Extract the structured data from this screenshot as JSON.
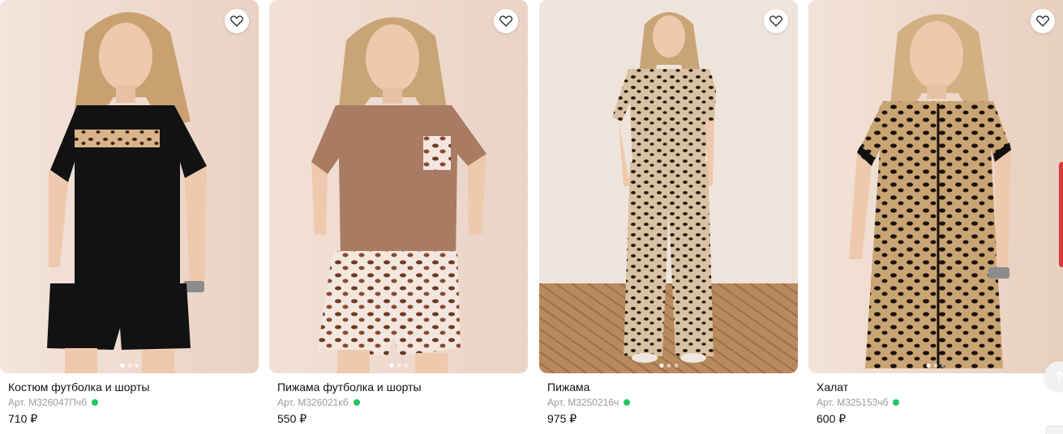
{
  "products": [
    {
      "title": "Костюм футболка и шорты",
      "sku": "Арт. М326047Пчб",
      "price": "710 ₽",
      "in_stock": true,
      "image_slides": 3,
      "active_slide": 1
    },
    {
      "title": "Пижама футболка и шорты",
      "sku": "Арт. М326021кб",
      "price": "550 ₽",
      "in_stock": true,
      "image_slides": 3,
      "active_slide": 1
    },
    {
      "title": "Пижама",
      "sku": "Арт. М3250216ч",
      "price": "975 ₽",
      "in_stock": true,
      "image_slides": 3,
      "active_slide": 1
    },
    {
      "title": "Халат",
      "sku": "Арт. М325153чб",
      "price": "600 ₽",
      "in_stock": true,
      "image_slides": 3,
      "active_slide": 1
    }
  ],
  "icons": {
    "favorite": "heart-outline-icon",
    "scroll_top": "arrow-up-icon",
    "in_stock": "green-dot"
  },
  "colors": {
    "in_stock": "#22c55e",
    "sku_text": "#9a9a9a",
    "title_text": "#111111",
    "photo_backdrop": "#f0ddd1"
  }
}
